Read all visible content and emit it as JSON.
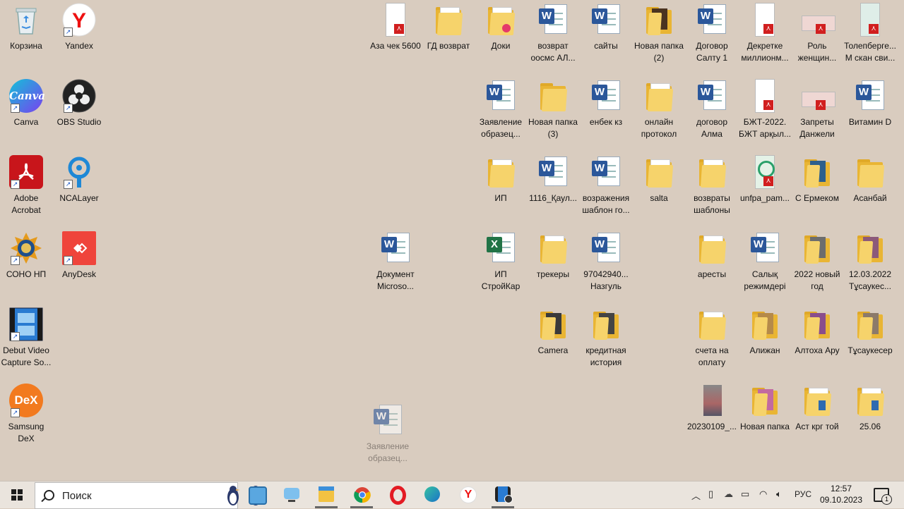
{
  "desktop": {
    "icons": {
      "recycle_bin": "Корзина",
      "yandex": "Yandex",
      "canva": "Canva",
      "obs": "OBS Studio",
      "acrobat": "Adobe Acrobat",
      "ncalayer": "NCALayer",
      "sono": "СОНО НП",
      "anydesk": "AnyDesk",
      "debut": "Debut Video Capture So...",
      "dex": "Samsung DeX",
      "aza_chek": "Аза чек 5600",
      "gd_vozvrat": "ГД возврат",
      "doki": "Доки",
      "vozvrat_oosms": "возврат оосмс АЛ...",
      "saity": "сайты",
      "new_folder_2": "Новая папка (2)",
      "dogovor_saltu": "Договор Салту 1",
      "dekretke": "Декретке миллионм...",
      "rol_zhensh": "Роль женщин...",
      "tolepbergen": "Толепберге... М скан сви...",
      "zayavlenie1": "Заявление образец...",
      "new_folder_3": "Новая папка (3)",
      "enbek": "енбек кз",
      "online_protocol": "онлайн протокол",
      "dogovor_alma": "договор Алма",
      "bzht_2022": "БЖТ-2022. БЖТ арқыл...",
      "zaprety": "Запреты Данжели",
      "vitamin_d": "Витамин D",
      "ip": "ИП",
      "f1116": "1116_Қаул...",
      "vozrazheniya": "возражения шаблон го...",
      "salta": "salta",
      "vozvraty_shablony": "возвраты шаблоны",
      "unfpa": "unfpa_pam...",
      "s_ermekom": "С Ермеком",
      "asanbai": "Асанбай",
      "document_ms": "Документ Microso...",
      "ip_stroikar": "ИП СтройКар",
      "trekery": "трекеры",
      "nazgul": "97042940... Назгуль",
      "aresty": "аресты",
      "salyk": "Салық режимдері",
      "new_year_2022": "2022 новый год",
      "tusaukes_2022": "12.03.2022 Тұсаукес...",
      "camera": "Camera",
      "kreditnaya": "кредитная история",
      "scheta": "счета на оплату",
      "alizhan": "Алижан",
      "altokha": "Алтоха Ару",
      "tusaukeser": "Тұсаукесер",
      "photo_2023": "20230109_...",
      "new_folder": "Новая папка",
      "ast_krg": "Аст крг той",
      "f2506": "25.06",
      "zayavlenie_ghost": "Заявление образец..."
    }
  },
  "taskbar": {
    "search_placeholder": "Поиск",
    "language": "РУС",
    "time": "12:57",
    "date": "09.10.2023",
    "notifications": "1"
  }
}
